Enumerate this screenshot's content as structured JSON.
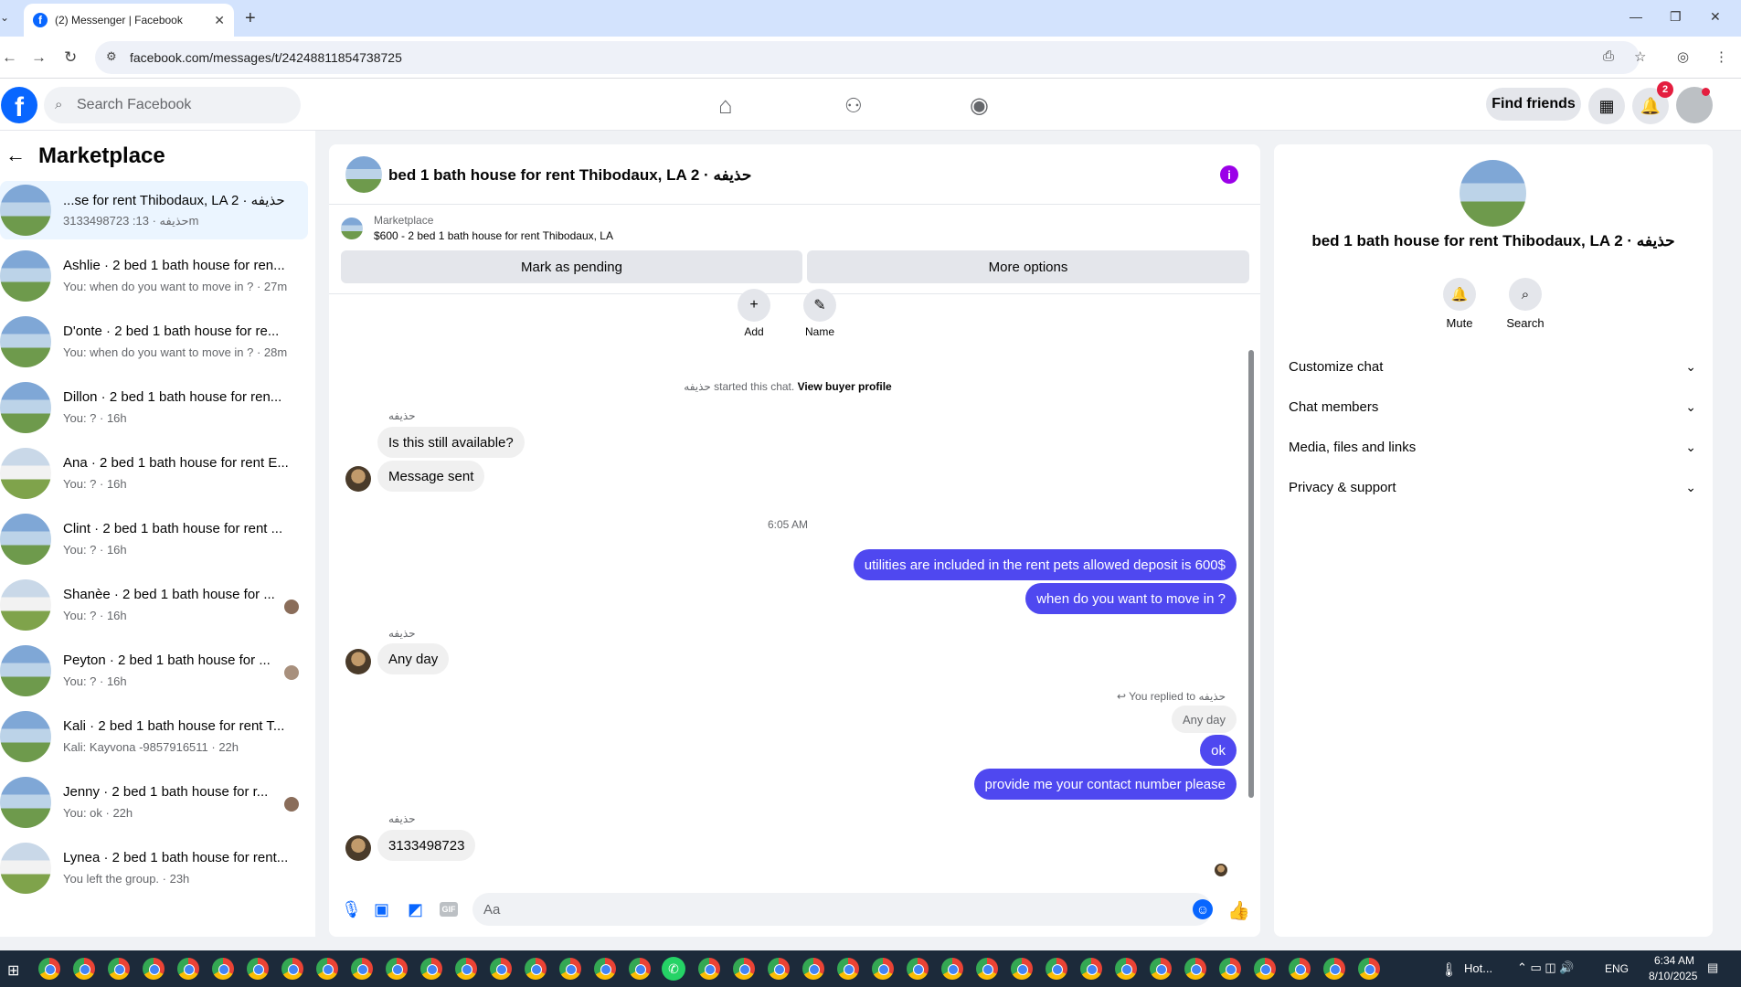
{
  "browser": {
    "tab_title": "(2) Messenger | Facebook",
    "url": "facebook.com/messages/t/24248811854738725"
  },
  "header": {
    "search_placeholder": "Search Facebook",
    "find_friends_label": "Find friends",
    "notification_count": "2"
  },
  "sidebar": {
    "title": "Marketplace",
    "conversations": [
      {
        "name": "...se for rent Thibodaux, LA 2 · حذيفه",
        "preview": "3133498723 :حذيفه · 13m",
        "active": true
      },
      {
        "name": "Ashlie · 2 bed 1 bath house for ren...",
        "preview": "You: when do you want to move in ? · 27m"
      },
      {
        "name": "D'onte · 2 bed 1 bath house for re...",
        "preview": "You: when do you want to move in ? · 28m"
      },
      {
        "name": "Dillon · 2 bed 1 bath house for ren...",
        "preview": "You: ? · 16h"
      },
      {
        "name": "Ana · 2 bed 1 bath house for rent E...",
        "preview": "You: ? · 16h"
      },
      {
        "name": "Clint · 2 bed 1 bath house for rent ...",
        "preview": "You: ? · 16h"
      },
      {
        "name": "Shanèe · 2 bed 1 bath house for ...",
        "preview": "You: ? · 16h"
      },
      {
        "name": "Peyton · 2 bed 1 bath house for ...",
        "preview": "You: ? · 16h"
      },
      {
        "name": "Kali · 2 bed 1 bath house for rent T...",
        "preview": "Kali: Kayvona -9857916511 · 22h"
      },
      {
        "name": "Jenny · 2 bed 1 bath house for r...",
        "preview": "You: ok · 22h"
      },
      {
        "name": "Lynea · 2 bed 1 bath house for rent...",
        "preview": "You left the group. · 23h"
      }
    ]
  },
  "chat": {
    "title": "bed 1 bath house for rent Thibodaux, LA 2 · حذيفه",
    "marketplace_label": "Marketplace",
    "listing": "$600 - 2 bed 1 bath house for rent Thibodaux, LA",
    "mark_pending": "Mark as pending",
    "more_options": "More options",
    "add_label": "Add",
    "name_label": "Name",
    "started_text": "حذيفه started this chat.",
    "view_buyer": "View buyer profile",
    "sender": "حذيفه",
    "msg1": "Is this still available?",
    "msg2": "Message sent",
    "timestamp": "6:05 AM",
    "out1": "utilities are included in the rent pets allowed deposit is 600$",
    "out2": "when do you want to move in ?",
    "msg3": "Any day",
    "replied_to": "You replied to حذيفه",
    "quoted": "Any day",
    "out3": "ok",
    "out4": "provide me your contact number please",
    "msg4": "3133498723",
    "composer_placeholder": "Aa"
  },
  "details": {
    "title": "bed 1 bath house for rent Thibodaux, LA 2 · حذيفه",
    "mute": "Mute",
    "search": "Search",
    "rows": [
      "Customize chat",
      "Chat members",
      "Media, files and links",
      "Privacy & support"
    ]
  },
  "taskbar": {
    "weather": "Hot...",
    "lang": "ENG",
    "time": "6:34 AM",
    "date": "8/10/2025"
  },
  "colors": {
    "accent": "#0866ff",
    "outgoing_bubble": "#4f48f0",
    "info": "#9b00e8"
  }
}
